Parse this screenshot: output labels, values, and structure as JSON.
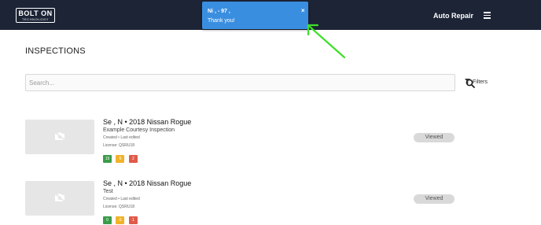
{
  "header": {
    "logo_main": "BOLT ON",
    "logo_sub": "TECHNOLOGY",
    "nav_title": "Auto Repair",
    "menu_icon": "hamburger-menu-icon"
  },
  "toast": {
    "title": "Ni        ,  - 97          ,",
    "message": "Thank you!",
    "close_label": "×"
  },
  "page": {
    "title": "INSPECTIONS"
  },
  "search": {
    "placeholder": "Search...",
    "value": "",
    "icon": "search-icon"
  },
  "filters": {
    "label": "Filters",
    "icon": "filter-icon"
  },
  "inspections": [
    {
      "title": "Se    , N        • 2018 Nissan Rogue",
      "subtitle": "Example Courtesy Inspection",
      "meta": "Created • Last edited",
      "license": "License: QSRU18",
      "counts": {
        "green": "19",
        "yellow": "6",
        "red": "2"
      },
      "status": "Viewed",
      "thumb_icon": "no-photo-icon"
    },
    {
      "title": "Se    , N        • 2018 Nissan Rogue",
      "subtitle": "Test",
      "meta": "Created • Last edited",
      "license": "License: QSRU18",
      "counts": {
        "green": "0",
        "yellow": "0",
        "red": "1"
      },
      "status": "Viewed",
      "thumb_icon": "no-photo-icon"
    }
  ],
  "colors": {
    "header_bg": "#1c2436",
    "toast_bg": "#3a8ee0",
    "arrow": "#3ee02a",
    "pill_green": "#3a9c4a",
    "pill_yellow": "#f0b32a",
    "pill_red": "#e05a4a"
  }
}
